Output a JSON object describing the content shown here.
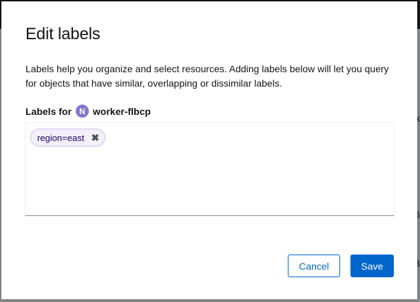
{
  "modal": {
    "title": "Edit labels",
    "description": "Labels help you organize and select resources. Adding labels below will let you query for objects that have similar, overlapping or dissimilar labels.",
    "labels_for_prefix": "Labels for",
    "resource_badge": "N",
    "resource_name": "worker-flbcp",
    "labels": [
      {
        "text": "region=east",
        "remove_glyph": "✖"
      }
    ],
    "input_value": "",
    "cancel_label": "Cancel",
    "save_label": "Save"
  },
  "background": {
    "fragments": [
      "x",
      "6",
      "3"
    ]
  },
  "colors": {
    "primary": "#0066cc",
    "badge": "#8476d1",
    "chip_bg": "#f3f0fc",
    "chip_border": "#c9c0ef"
  },
  "icons": {
    "chip_remove": "close-icon"
  }
}
